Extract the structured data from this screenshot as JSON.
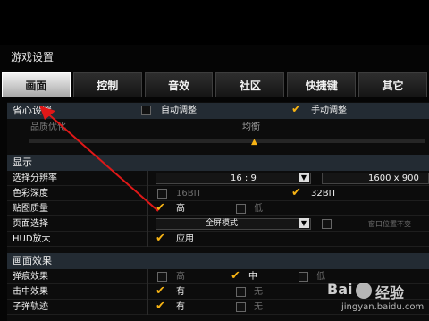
{
  "window": {
    "title": "游戏设置"
  },
  "tabs": [
    {
      "label": "画面",
      "active": true
    },
    {
      "label": "控制"
    },
    {
      "label": "音效"
    },
    {
      "label": "社区"
    },
    {
      "label": "快捷键"
    },
    {
      "label": "其它"
    }
  ],
  "top_section": {
    "label": "省心设置",
    "auto_label": "自动调整",
    "manual_label": "手动调整",
    "quality_label": "品质优化",
    "quality_value": "均衡"
  },
  "display": {
    "header": "显示",
    "resolution_label": "选择分辨率",
    "resolution_ratio": "16 : 9",
    "resolution_value": "1600 x 900",
    "color_depth_label": "色彩深度",
    "color_16": "16BIT",
    "color_32": "32BIT",
    "texture_label": "贴图质量",
    "texture_high": "高",
    "texture_low": "低",
    "page_label": "页面选择",
    "page_mode": "全屏模式",
    "page_position": "窗口位置不变",
    "hud_label": "HUD放大",
    "hud_apply": "应用"
  },
  "effects": {
    "header": "画面效果",
    "bullet_label": "弹痕效果",
    "bullet_high": "高",
    "bullet_mid": "中",
    "bullet_low": "低",
    "blood_label": "击中效果",
    "blood_yes": "有",
    "blood_no": "无",
    "trail_label": "子弹轨迹",
    "trail_yes": "有",
    "trail_no": "无"
  },
  "watermark": {
    "brand": "Bai",
    "brand_tail": "经验",
    "url": "jingyan.baidu.com"
  },
  "colors": {
    "accent": "#f7b314",
    "arrow": "#e01818",
    "header_bg": "#232b33"
  }
}
